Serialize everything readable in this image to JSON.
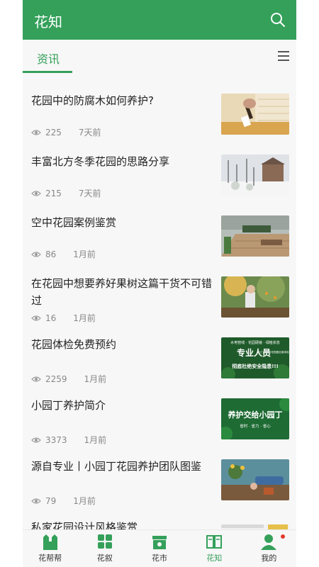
{
  "header": {
    "title": "花知",
    "search_icon": "search-icon"
  },
  "tabs": {
    "active": "资讯",
    "menu_icon": "menu-icon"
  },
  "articles": [
    {
      "title": "花园中的防腐木如何养护?",
      "views": "225",
      "time": "7天前"
    },
    {
      "title": "丰富北方冬季花园的思路分享",
      "views": "215",
      "time": "7天前"
    },
    {
      "title": "空中花园案例鉴赏",
      "views": "86",
      "time": "1月前"
    },
    {
      "title": "在花园中想要养好果树这篇干货不可错过",
      "views": "16",
      "time": "1月前"
    },
    {
      "title": "花园体检免费预约",
      "views": "2259",
      "time": "1月前",
      "thumb_text": [
        "水电管线 · 花园硬装 · 绿植状态",
        "专业人员",
        "上门为您的花园做全面体检",
        "彻底杜绝安全隐患!!!"
      ]
    },
    {
      "title": "小园丁养护简介",
      "views": "3373",
      "time": "1月前",
      "thumb_text": [
        "养护交给小园丁",
        "省时 · 省力 · 省心"
      ]
    },
    {
      "title": "源自专业丨小园丁花园养护团队图鉴",
      "views": "79",
      "time": "1月前"
    },
    {
      "title": "私家花园设计风格鉴赏",
      "views": "",
      "time": ""
    }
  ],
  "nav": [
    {
      "label": "花帮帮",
      "icon": "garden-help-icon"
    },
    {
      "label": "花叙",
      "icon": "flower-story-icon"
    },
    {
      "label": "花市",
      "icon": "market-icon"
    },
    {
      "label": "花知",
      "icon": "book-icon",
      "active": true
    },
    {
      "label": "我的",
      "icon": "user-icon",
      "badge": true
    }
  ],
  "colors": {
    "brand": "#34a05a",
    "badge": "#e23a2b"
  }
}
